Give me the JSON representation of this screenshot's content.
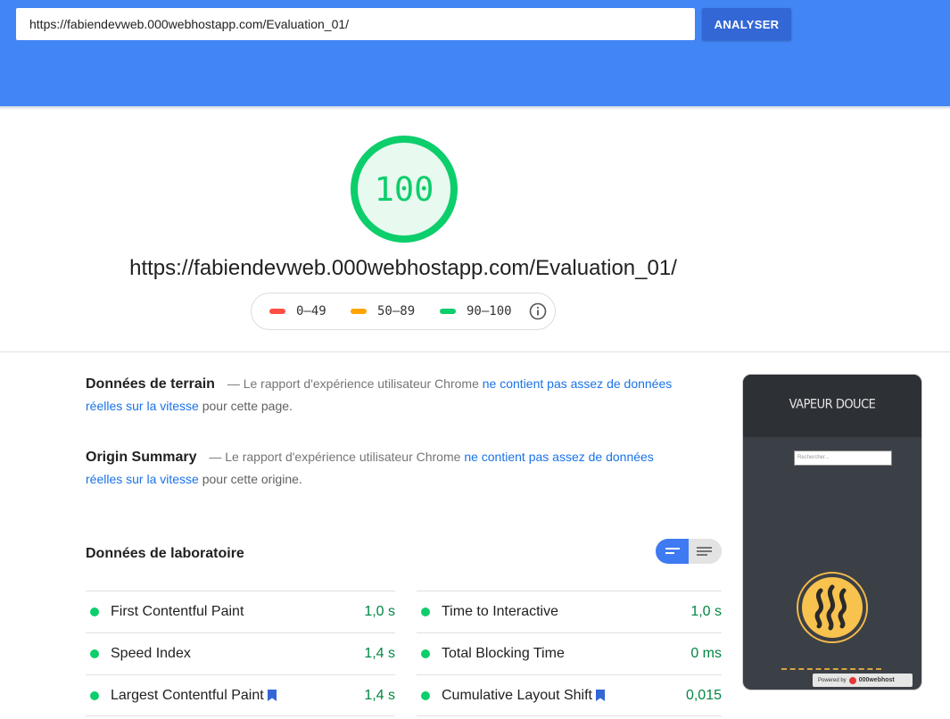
{
  "header": {
    "url_value": "https://fabiendevweb.000webhostapp.com/Evaluation_01/",
    "analyze_label": "ANALYSER",
    "brand_color": "#4285f4"
  },
  "score": {
    "value": "100",
    "score_fraction": 1.0,
    "tested_url": "https://fabiendevweb.000webhostapp.com/Evaluation_01/",
    "color": "#0cce6b"
  },
  "legend": {
    "ranges": [
      {
        "label": "0–49",
        "color": "#ff4e42"
      },
      {
        "label": "50–89",
        "color": "#ffa400"
      },
      {
        "label": "90–100",
        "color": "#0cce6b"
      }
    ],
    "info_icon": "info-icon"
  },
  "field_data": {
    "heading": "Données de terrain",
    "intro": "— Le rapport d'expérience utilisateur Chrome",
    "link": "ne contient pas assez de données réelles sur la vitesse",
    "suffix": "pour cette page."
  },
  "origin_summary": {
    "heading": "Origin Summary",
    "intro": "— Le rapport d'expérience utilisateur Chrome",
    "link": "ne contient pas assez de données réelles sur la vitesse",
    "suffix": "pour cette origine."
  },
  "lab": {
    "title": "Données de laboratoire",
    "metrics_left": [
      {
        "name": "First Contentful Paint",
        "value": "1,0 s",
        "bookmark": false
      },
      {
        "name": "Speed Index",
        "value": "1,4 s",
        "bookmark": false
      },
      {
        "name": "Largest Contentful Paint",
        "value": "1,4 s",
        "bookmark": true
      }
    ],
    "metrics_right": [
      {
        "name": "Time to Interactive",
        "value": "1,0 s",
        "bookmark": false
      },
      {
        "name": "Total Blocking Time",
        "value": "0 ms",
        "bookmark": false
      },
      {
        "name": "Cumulative Layout Shift",
        "value": "0,015",
        "bookmark": true
      }
    ]
  },
  "thumbnail": {
    "site_title": "VAPEUR DOUCE",
    "search_placeholder": "Rechercher...",
    "footer_prefix": "Powered by",
    "footer_host": "000webhost"
  }
}
